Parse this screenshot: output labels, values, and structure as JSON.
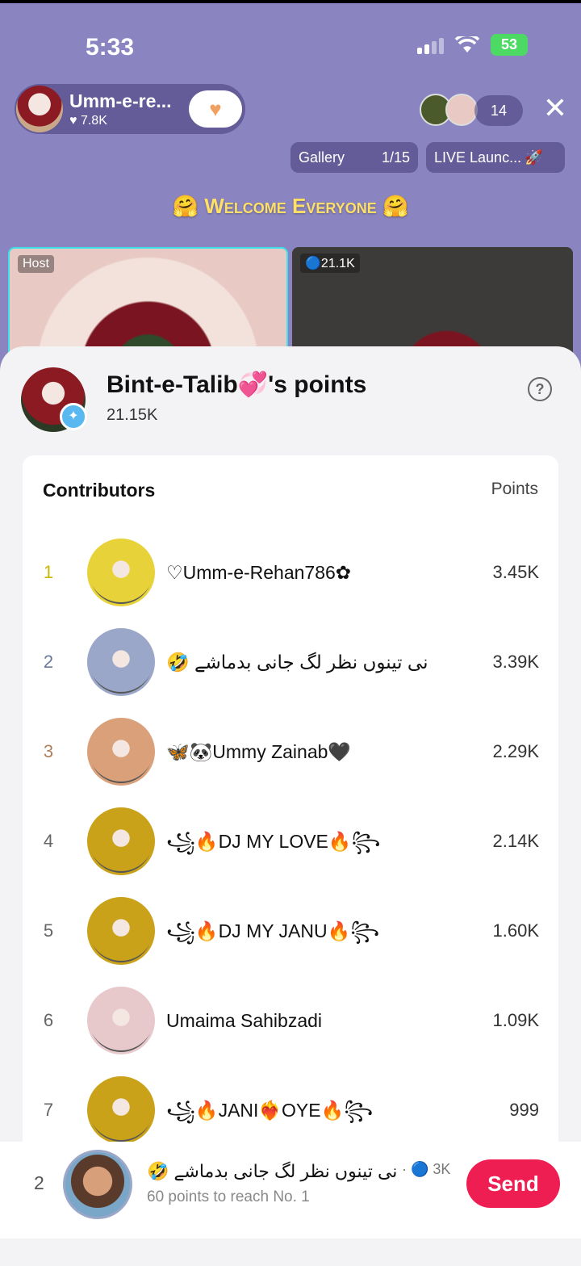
{
  "status": {
    "time": "5:33",
    "battery": "53"
  },
  "host": {
    "name": "Umm-e-re...",
    "likes": "♥ 7.8K",
    "follow_icon": "heart-icon",
    "viewer_count": "14"
  },
  "toolbar": {
    "gallery_label": "Gallery",
    "gallery_page": "1/15",
    "launch_label": "LIVE Launc..."
  },
  "welcome": "🤗 Welcome Everyone 🤗",
  "tiles": {
    "host_tag": "Host",
    "guest_score": "🔵21.1K"
  },
  "sheet": {
    "title": "Bint-e-Talib💞's points",
    "subtitle": "21.15K",
    "help_icon": "question-icon",
    "col_contributors": "Contributors",
    "col_points": "Points",
    "contributors": [
      {
        "rank": "1",
        "name": "♡Umm-e-Rehan786✿",
        "points": "3.45K",
        "rank_color": "#c9b800",
        "avatar_color": "#e8d23a"
      },
      {
        "rank": "2",
        "name": "🤣 نی تینوں نظر لگ جانی بدماشے",
        "points": "3.39K",
        "rank_color": "#6b7a99",
        "avatar_color": "#9aa7c8"
      },
      {
        "rank": "3",
        "name": "🦋🐼Ummy Zainab🖤",
        "points": "2.29K",
        "rank_color": "#b0805a",
        "avatar_color": "#d9a07a"
      },
      {
        "rank": "4",
        "name": "꧁🔥DJ MY LOVE🔥꧂",
        "points": "2.14K",
        "rank_color": "#666666",
        "avatar_color": "#c9a21a"
      },
      {
        "rank": "5",
        "name": "꧁🔥DJ MY JANU🔥꧂",
        "points": "1.60K",
        "rank_color": "#666666",
        "avatar_color": "#c9a21a"
      },
      {
        "rank": "6",
        "name": "Umaima Sahibzadi",
        "points": "1.09K",
        "rank_color": "#666666",
        "avatar_color": "#e7c9cc"
      },
      {
        "rank": "7",
        "name": "꧁🔥JANI❤️‍🔥OYE🔥꧂",
        "points": "999",
        "rank_color": "#666666",
        "avatar_color": "#c9a21a"
      }
    ]
  },
  "footer": {
    "rank": "2",
    "name": "🤣 نی تینوں نظر لگ جانی بدماشے",
    "score": "· 🔵 3K",
    "hint": "60 points to reach No. 1",
    "send_label": "Send"
  }
}
